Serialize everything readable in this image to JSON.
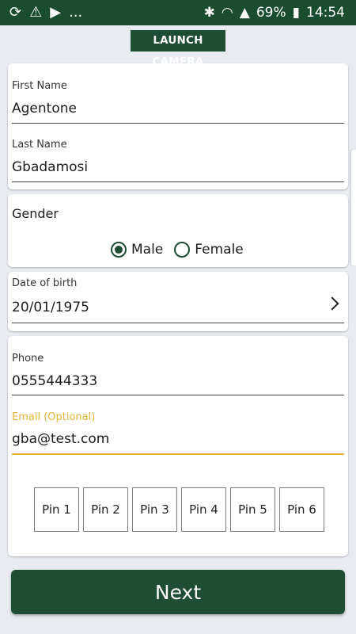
{
  "status_bar": {
    "left_icons": [
      "sync-icon",
      "warning-icon",
      "play-store-icon"
    ],
    "more": "...",
    "battery": "69%",
    "time": "14:54",
    "right_icons": [
      "bluetooth-icon",
      "wifi-icon",
      "signal-icon",
      "battery-icon"
    ]
  },
  "launch_camera": "LAUNCH CAMERA",
  "name_card": {
    "first_name_label": "First Name",
    "first_name_value": "Agentone",
    "last_name_label": "Last Name",
    "last_name_value": "Gbadamosi"
  },
  "gender_card": {
    "label": "Gender",
    "options": [
      "Male",
      "Female"
    ],
    "selected": "Male"
  },
  "dob_card": {
    "label": "Date of birth",
    "value": "20/01/1975"
  },
  "contact_card": {
    "phone_label": "Phone",
    "phone_value": "0555444333",
    "email_label": "Email (Optional)",
    "email_value": "gba@test.com",
    "pins": [
      "Pin 1",
      "Pin 2",
      "Pin 3",
      "Pin 4",
      "Pin 5",
      "Pin 6"
    ]
  },
  "next_button": "Next",
  "colors": {
    "primary": "#1f4d34",
    "status_bar": "#1a4c2f",
    "accent": "#e0b53a",
    "background": "#e8ecf0"
  }
}
